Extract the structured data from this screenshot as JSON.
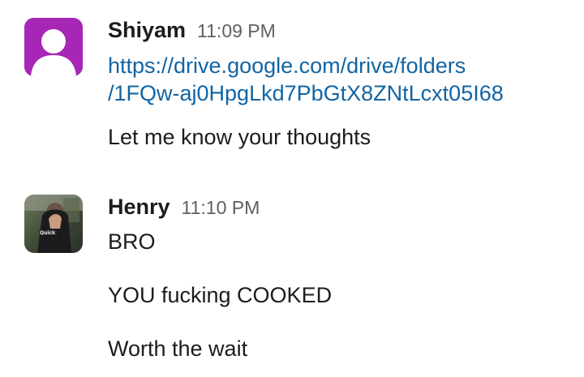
{
  "messages": [
    {
      "sender": "Shiyam",
      "time": "11:09 PM",
      "avatar": {
        "icon": "default-user-icon",
        "bg": "#a726b6",
        "fg": "#ffffff"
      },
      "link_line1": "https://drive.google.com/drive/folders",
      "link_line2": "/1FQw-aj0HpgLkd7PbGtX8ZNtLcxt05I68",
      "text": "Let me know your thoughts"
    },
    {
      "sender": "Henry",
      "time": "11:10 PM",
      "avatar": {
        "icon": "user-photo-icon",
        "shirt_text": "Quick"
      },
      "lines": [
        "BRO",
        "YOU fucking COOKED",
        "Worth the wait"
      ]
    }
  ],
  "colors": {
    "link": "#1264a3",
    "text": "#1d1c1d",
    "timestamp": "#616061"
  }
}
